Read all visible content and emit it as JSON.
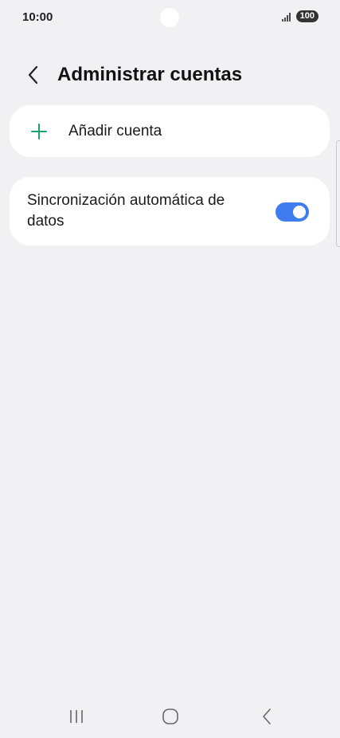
{
  "status_bar": {
    "time": "10:00",
    "battery": "100"
  },
  "header": {
    "title": "Administrar cuentas",
    "back_icon": "chevron-left-icon"
  },
  "add_account": {
    "label": "Añadir cuenta",
    "icon": "plus-icon",
    "icon_color": "#1aa36b"
  },
  "auto_sync": {
    "label": "Sincronización automática de datos",
    "enabled": true,
    "toggle_color": "#3f7cf0"
  },
  "nav_bar": {
    "recent_icon": "recent-apps-icon",
    "home_icon": "home-icon",
    "back_icon": "back-icon"
  }
}
